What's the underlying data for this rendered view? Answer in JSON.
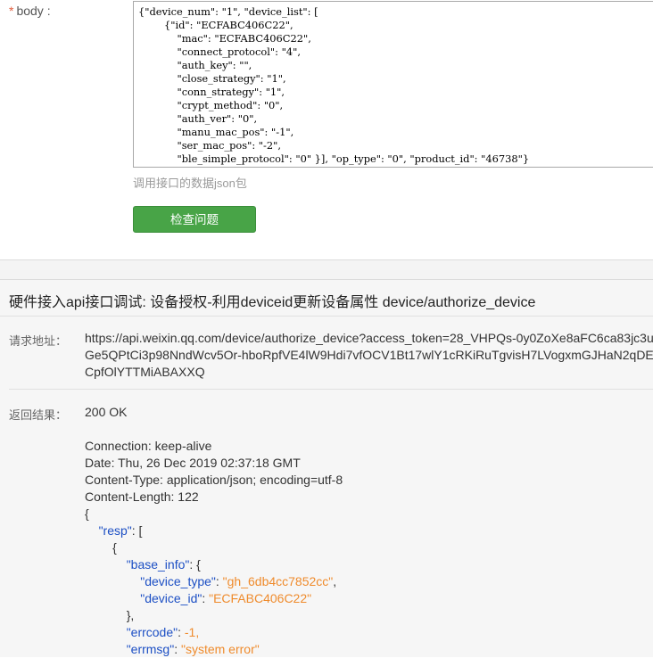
{
  "form": {
    "required_mark": "*",
    "body_label": "body :",
    "body_lines": [
      "{\"device_num\": \"1\", \"device_list\": [",
      "        {\"id\": \"ECFABC406C22\",",
      "            \"mac\": \"ECFABC406C22\",",
      "            \"connect_protocol\": \"4\",",
      "            \"auth_key\": \"\",",
      "            \"close_strategy\": \"1\",",
      "            \"conn_strategy\": \"1\",",
      "            \"crypt_method\": \"0\",",
      "            \"auth_ver\": \"0\",",
      "            \"manu_mac_pos\": \"-1\",",
      "            \"ser_mac_pos\": \"-2\",",
      "            \"ble_simple_protocol\": \"0\" }], \"op_type\": \"0\", \"product_id\": \"46738\"}"
    ],
    "hint": "调用接口的数据json包",
    "check_button": "检查问题"
  },
  "result": {
    "title": "硬件接入api接口调试: 设备授权-利用deviceid更新设备属性 device/authorize_device",
    "request_label": "请求地址：",
    "request_url": "https://api.weixin.qq.com/device/authorize_device?access_token=28_VHPQs-0y0ZoXe8aFC6ca83jc3uGe5QPtCi3p98NndWcv5Or-hboRpfVE4lW9Hdi7vfOCV1Bt17wlY1cRKiRuTgvisH7LVogxmGJHaN2qDECpfOlYTTMiABAXXQ",
    "return_label": "返回结果：",
    "status": "200 OK",
    "headers": [
      "Connection: keep-alive",
      "Date: Thu, 26 Dec 2019 02:37:18 GMT",
      "Content-Type: application/json; encoding=utf-8",
      "Content-Length: 122"
    ],
    "json": {
      "open_brace": "{",
      "resp_key": "\"resp\"",
      "resp_tail": ": [",
      "item_open": "{",
      "base_info_key": "\"base_info\"",
      "base_info_tail": ": {",
      "device_type_key": "\"device_type\"",
      "device_type_val": "\"gh_6db4cc7852cc\"",
      "device_id_key": "\"device_id\"",
      "device_id_val": "\"ECFABC406C22\"",
      "base_info_close": "},",
      "errcode_key": "\"errcode\"",
      "errcode_val": "-1,",
      "errmsg_key": "\"errmsg\"",
      "errmsg_val": "\"system error\""
    }
  },
  "colors": {
    "json_key": "#1c4fc4",
    "json_value": "#ef8b2c",
    "button": "#48a447",
    "required": "#e15f3f"
  }
}
